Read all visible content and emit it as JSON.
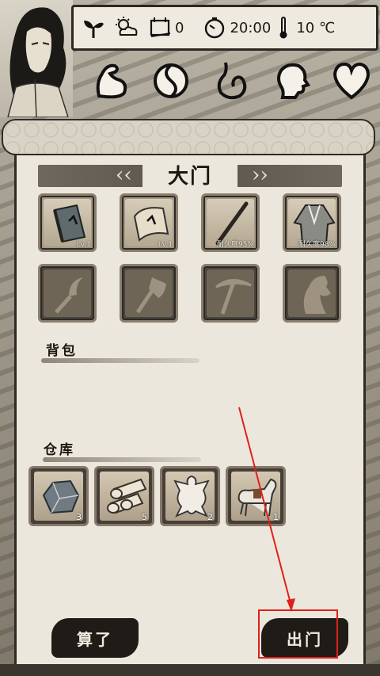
{
  "topbar": {
    "icons": [
      "sprout-icon",
      "weather-icon",
      "calendar-icon",
      "clock-icon",
      "thermometer-icon"
    ],
    "days_value": "0",
    "time_value": "20:00",
    "temperature_value": "10 ℃"
  },
  "stats": [
    "strength-icon",
    "yin-yang-icon",
    "stomach-icon",
    "head-icon",
    "heart-icon"
  ],
  "location": {
    "prev_chevron": "‹‹",
    "next_chevron": "››",
    "title": "大门"
  },
  "equipment": [
    {
      "icon": "book-icon",
      "label": "Lv.1"
    },
    {
      "icon": "scroll-icon",
      "label": "Lv.1"
    },
    {
      "icon": "staff-icon",
      "label": "耐久度95%"
    },
    {
      "icon": "robe-icon",
      "label": "耐久度98%"
    }
  ],
  "tools": [
    "sickle-icon",
    "axe-icon",
    "pickaxe-icon",
    "horse-head-icon"
  ],
  "sections": {
    "backpack": "背包",
    "warehouse": "仓库"
  },
  "warehouse_items": [
    {
      "icon": "stone-icon",
      "count": "3"
    },
    {
      "icon": "logs-icon",
      "count": "5"
    },
    {
      "icon": "fur-icon",
      "count": "2"
    },
    {
      "icon": "horse-icon",
      "count": "1"
    }
  ],
  "buttons": {
    "cancel": "算了",
    "go_out": "出门"
  },
  "colors": {
    "highlight": "#e0201a",
    "button_bg": "#1f1c18",
    "panel_bg": "#ece7dc"
  }
}
